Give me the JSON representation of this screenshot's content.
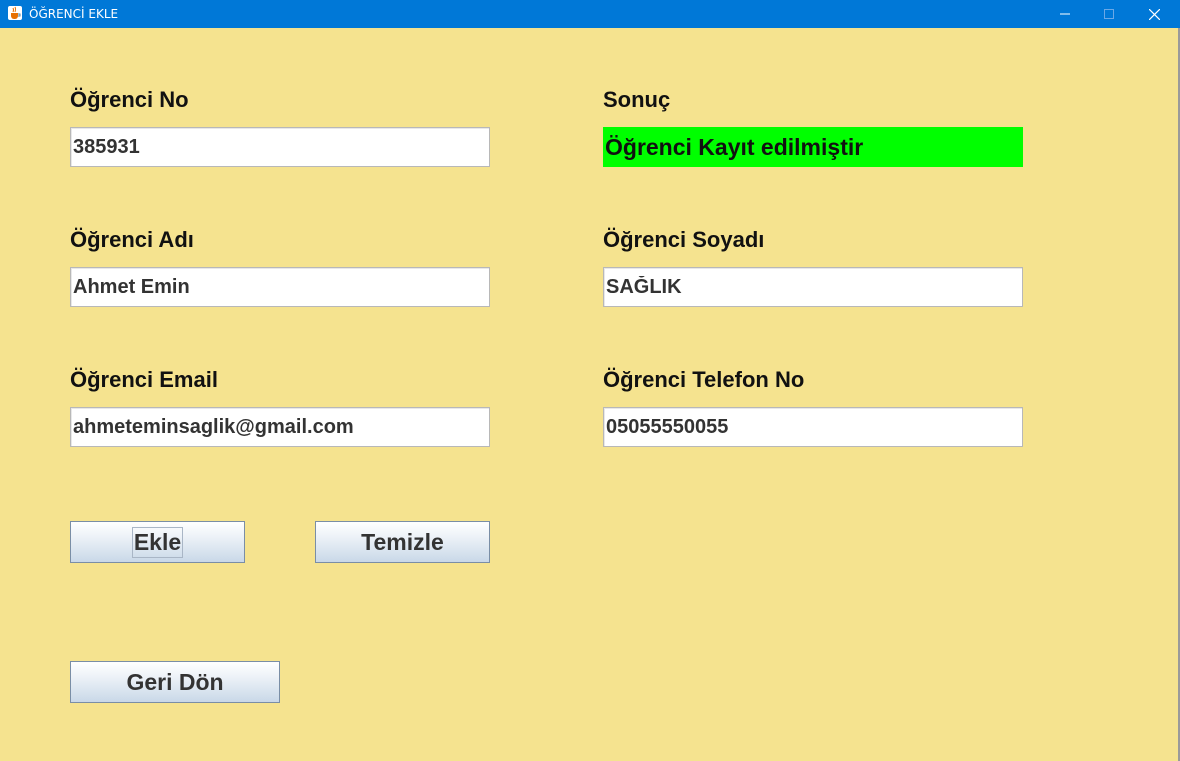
{
  "window": {
    "title": "ÖĞRENCİ EKLE",
    "icon": "java-cup-icon",
    "controls": [
      "minimize-icon",
      "maximize-icon",
      "close-icon"
    ]
  },
  "colors": {
    "background": "#f5e38f",
    "titlebar": "#0078d7",
    "result_bg": "#00ff00"
  },
  "form": {
    "student_no": {
      "label": "Öğrenci No",
      "value": "385931"
    },
    "result": {
      "label": "Sonuç",
      "value": "Öğrenci Kayıt edilmiştir"
    },
    "first_name": {
      "label": "Öğrenci Adı",
      "value": "Ahmet Emin"
    },
    "last_name": {
      "label": "Öğrenci Soyadı",
      "value": "SAĞLIK"
    },
    "email": {
      "label": "Öğrenci Email",
      "value": "ahmeteminsaglik@gmail.com"
    },
    "phone": {
      "label": "Öğrenci Telefon No",
      "value": "05055550055"
    }
  },
  "buttons": {
    "add": "Ekle",
    "clear": "Temizle",
    "back": "Geri Dön"
  }
}
